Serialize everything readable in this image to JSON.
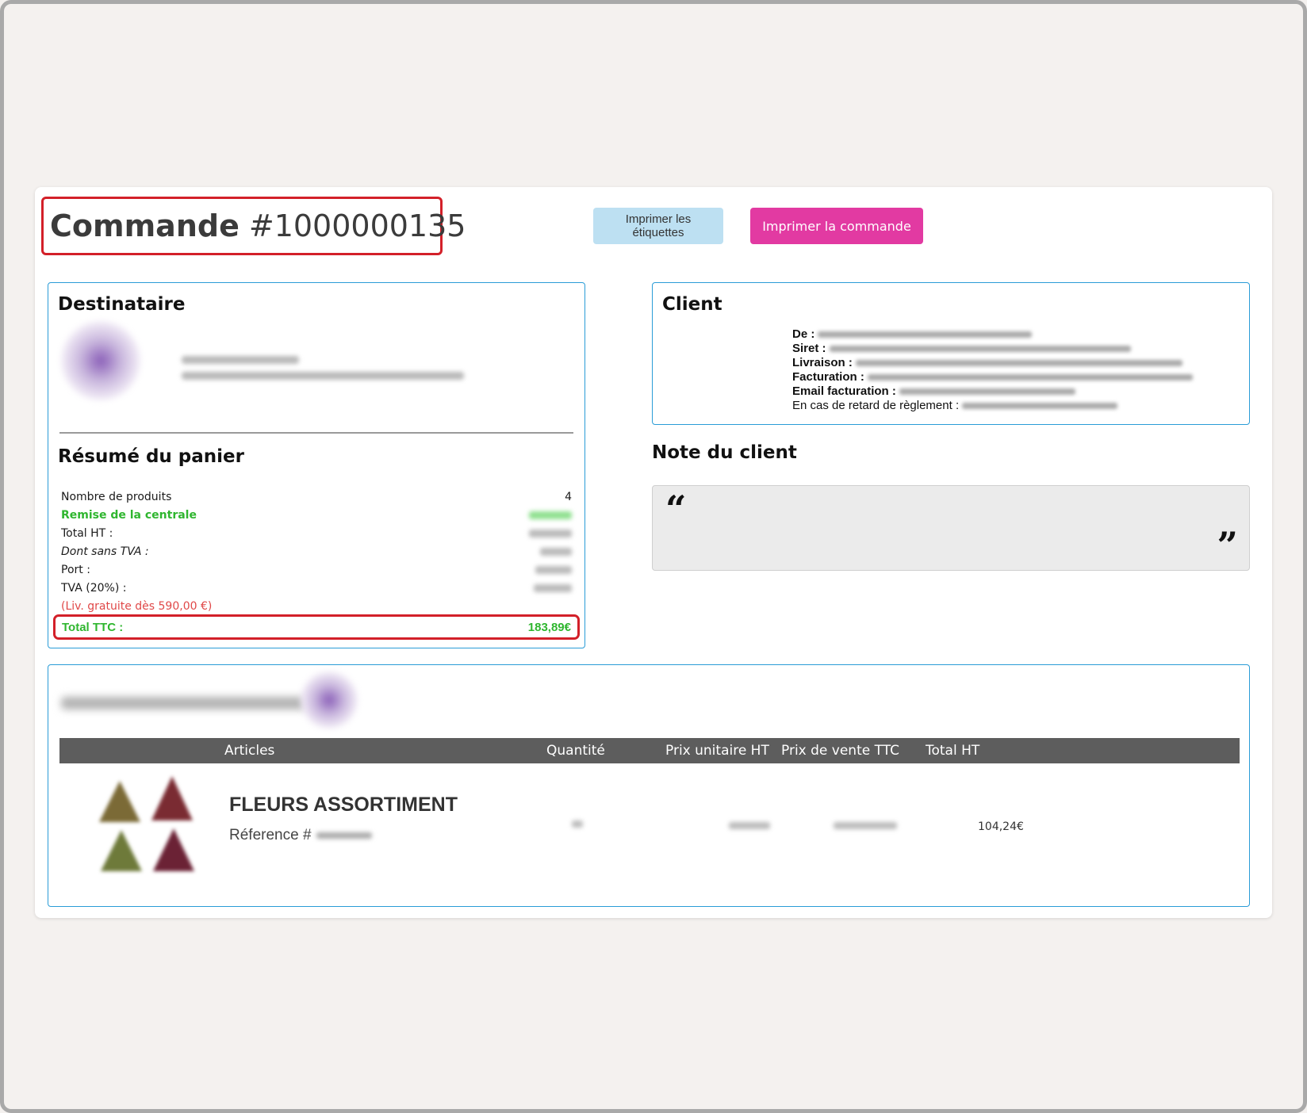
{
  "order": {
    "title_label": "Commande",
    "title_number": "#1000000135"
  },
  "toolbar": {
    "print_labels": "Imprimer les étiquettes",
    "print_order": "Imprimer la commande"
  },
  "recipient": {
    "heading": "Destinataire"
  },
  "cart_summary": {
    "heading": "Résumé du panier",
    "rows": [
      {
        "label": "Nombre de produits",
        "value": "4"
      },
      {
        "label": "Remise de la centrale",
        "value": ""
      },
      {
        "label": "Total HT :",
        "value": ""
      },
      {
        "label": "Dont sans TVA :",
        "value": ""
      },
      {
        "label": "Port :",
        "value": ""
      },
      {
        "label": "TVA (20%) :",
        "value": ""
      },
      {
        "label": "(Liv. gratuite dès 590,00 €)",
        "value": ""
      }
    ],
    "total_label": "Total TTC :",
    "total_value": "183,89€"
  },
  "client": {
    "heading": "Client",
    "fields": [
      {
        "label": "De :"
      },
      {
        "label": "Siret :"
      },
      {
        "label": "Livraison :"
      },
      {
        "label": "Facturation :"
      },
      {
        "label": "Email facturation :"
      },
      {
        "label": "En cas de retard de règlement :"
      }
    ]
  },
  "client_note": {
    "heading": "Note du client",
    "open_quote": "“",
    "close_quote": "”"
  },
  "products_table": {
    "columns": [
      "Articles",
      "Quantité",
      "Prix unitaire HT",
      "Prix de vente TTC",
      "Total HT"
    ],
    "rows": [
      {
        "name": "FLEURS ASSORTIMENT",
        "reference_label": "Réference #",
        "total_ht": "104,24€"
      }
    ]
  },
  "colors": {
    "accent_pink": "#e23aa2",
    "button_light_blue": "#bde0f2",
    "box_border_blue": "#2a9cd7",
    "highlight_red": "#d32029",
    "green_text": "#2fb62f",
    "table_header": "#5d5d5d"
  }
}
